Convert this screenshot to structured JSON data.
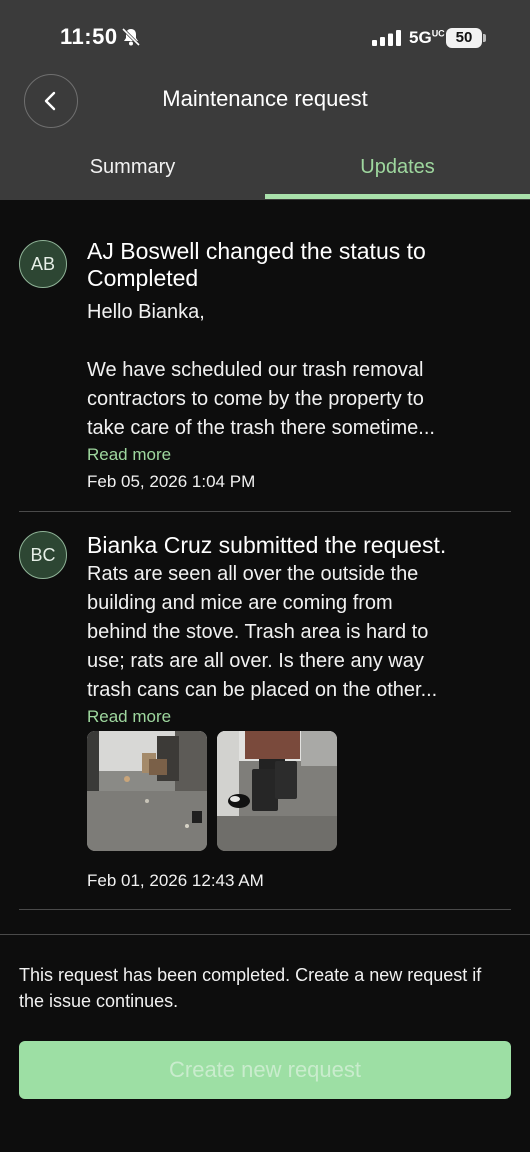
{
  "status_bar": {
    "time": "11:50",
    "network": "5G",
    "network_sup": "UC",
    "battery": "50",
    "icons": [
      "bell-slash-icon",
      "signal-icon",
      "battery-icon"
    ]
  },
  "header": {
    "title": "Maintenance request",
    "back_icon": "chevron-left-icon"
  },
  "tabs": [
    {
      "label": "Summary",
      "active": false
    },
    {
      "label": "Updates",
      "active": true
    }
  ],
  "updates": [
    {
      "initials": "AB",
      "title": "AJ Boswell changed the status to Completed",
      "body_lines": [
        "Hello Bianka,",
        "",
        "We have scheduled our trash removal",
        "contractors to come by the property to",
        "take care of the trash there sometime..."
      ],
      "read_more": "Read more",
      "date": "Feb 05, 2026 1:04 PM"
    },
    {
      "initials": "BC",
      "title": "Bianka Cruz submitted the request.",
      "body_lines": [
        "Rats are seen all over the outside the",
        "building and mice are coming from",
        "behind the stove. Trash area is hard to",
        "use; rats are all over. Is there any way",
        "trash cans can be placed on the other..."
      ],
      "read_more": "Read more",
      "attachments": [
        "trash-photo-1",
        "trash-photo-2"
      ],
      "date": "Feb 01, 2026 12:43 AM"
    }
  ],
  "footer": {
    "message": "This request has been completed. Create a new request if the issue continues.",
    "button_label": "Create new request"
  },
  "colors": {
    "accent": "#9ed79e",
    "header_bg": "#3b3b3b",
    "page_bg": "#0d0d0d",
    "button_bg": "#9ddfa4"
  }
}
